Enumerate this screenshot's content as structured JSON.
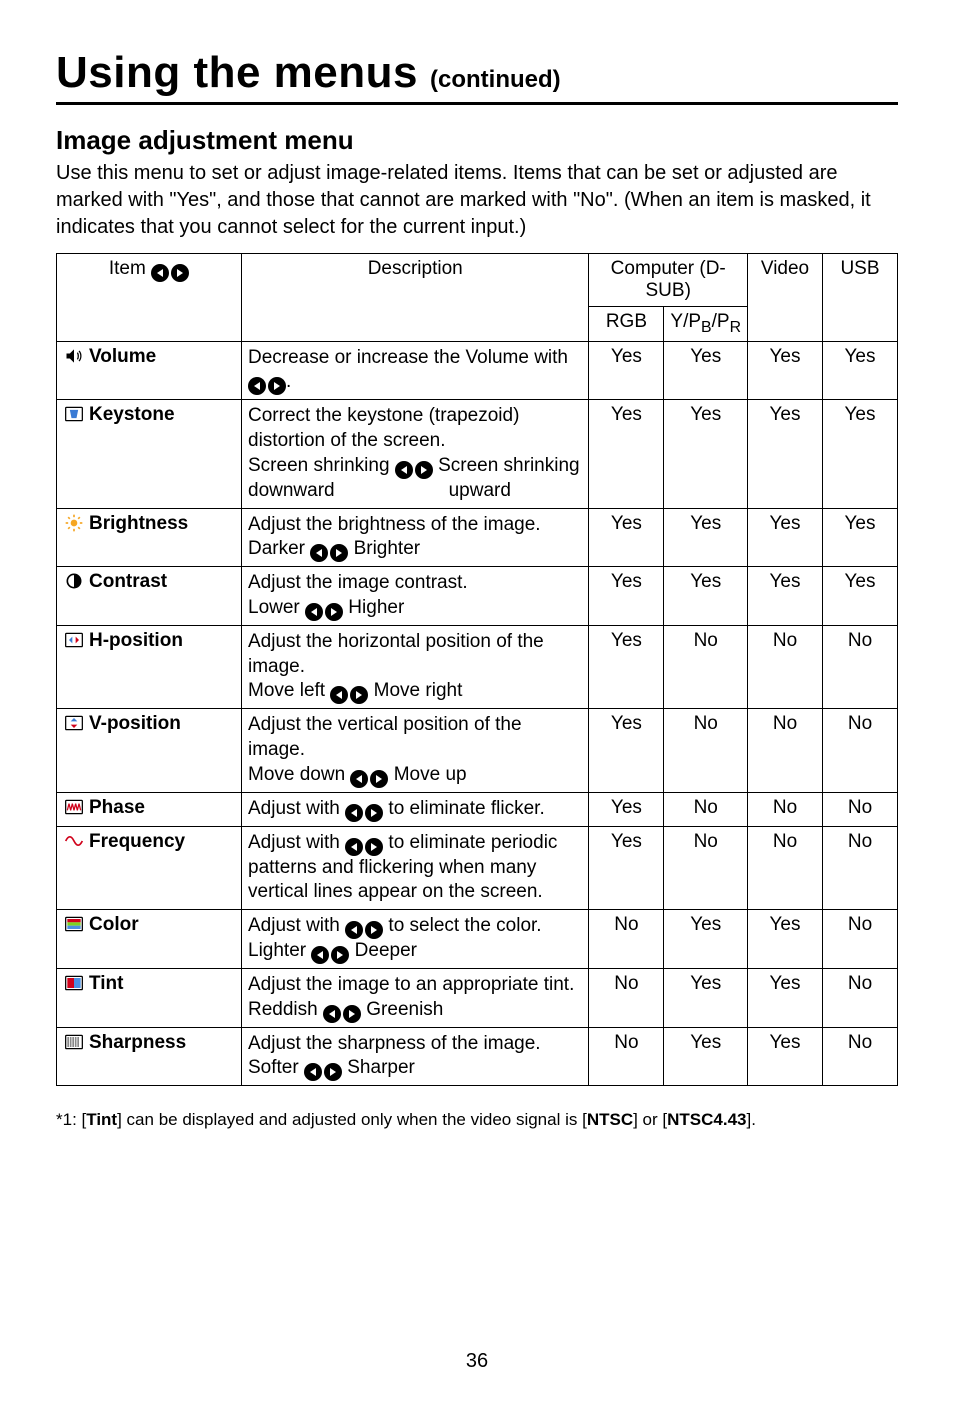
{
  "title": "Using the menus",
  "continued": "(continued)",
  "section_title": "Image adjustment menu",
  "section_intro": "Use this menu to set or adjust image-related items. Items that can be set or adjusted are marked with \"Yes\", and those that cannot are marked with \"No\". (When an item is masked, it indicates that you cannot select for the current input.)",
  "headers": {
    "item": "Item",
    "description": "Description",
    "dsub": "Computer (D-SUB)",
    "rgb": "RGB",
    "ypbpr": "Y/P",
    "ypbpr_b": "B",
    "ypbpr_sep": "/P",
    "ypbpr_r": "R",
    "video": "Video",
    "usb": "USB"
  },
  "rows": [
    {
      "icon": "volume",
      "label": "Volume",
      "desc_parts": [
        {
          "t": "text",
          "v": "Decrease or increase the Volume with "
        },
        {
          "t": "lr"
        },
        {
          "t": "text",
          "v": "."
        }
      ],
      "rgb": "Yes",
      "ypbpr": "Yes",
      "video": "Yes",
      "usb": "Yes"
    },
    {
      "icon": "keystone",
      "label": "Keystone",
      "desc_parts": [
        {
          "t": "text",
          "v": "Correct the keystone (trapezoid) distortion of the screen."
        },
        {
          "t": "br"
        },
        {
          "t": "text",
          "v": "Screen shrinking "
        },
        {
          "t": "lr"
        },
        {
          "t": "text",
          "v": " Screen shrinking"
        },
        {
          "t": "br"
        },
        {
          "t": "text",
          "v": "downward      upward"
        }
      ],
      "rgb": "Yes",
      "ypbpr": "Yes",
      "video": "Yes",
      "usb": "Yes"
    },
    {
      "icon": "brightness",
      "label": "Brightness",
      "desc_parts": [
        {
          "t": "text",
          "v": "Adjust the brightness of the image."
        },
        {
          "t": "br"
        },
        {
          "t": "text",
          "v": "Darker "
        },
        {
          "t": "lr"
        },
        {
          "t": "text",
          "v": " Brighter"
        }
      ],
      "rgb": "Yes",
      "ypbpr": "Yes",
      "video": "Yes",
      "usb": "Yes"
    },
    {
      "icon": "contrast",
      "label": "Contrast",
      "desc_parts": [
        {
          "t": "text",
          "v": "Adjust the image contrast."
        },
        {
          "t": "br"
        },
        {
          "t": "text",
          "v": "Lower "
        },
        {
          "t": "lr"
        },
        {
          "t": "text",
          "v": " Higher"
        }
      ],
      "rgb": "Yes",
      "ypbpr": "Yes",
      "video": "Yes",
      "usb": "Yes"
    },
    {
      "icon": "hpos",
      "label": "H-position",
      "desc_parts": [
        {
          "t": "text",
          "v": "Adjust the horizontal position of the image."
        },
        {
          "t": "br"
        },
        {
          "t": "text",
          "v": "Move left "
        },
        {
          "t": "lr"
        },
        {
          "t": "text",
          "v": " Move right"
        }
      ],
      "rgb": "Yes",
      "ypbpr": "No",
      "video": "No",
      "usb": "No"
    },
    {
      "icon": "vpos",
      "label": "V-position",
      "desc_parts": [
        {
          "t": "text",
          "v": "Adjust the vertical position of the image."
        },
        {
          "t": "br"
        },
        {
          "t": "text",
          "v": "Move down "
        },
        {
          "t": "lr"
        },
        {
          "t": "text",
          "v": " Move up"
        }
      ],
      "rgb": "Yes",
      "ypbpr": "No",
      "video": "No",
      "usb": "No"
    },
    {
      "icon": "phase",
      "label": "Phase",
      "desc_parts": [
        {
          "t": "text",
          "v": "Adjust with "
        },
        {
          "t": "lr"
        },
        {
          "t": "text",
          "v": " to eliminate flicker."
        }
      ],
      "rgb": "Yes",
      "ypbpr": "No",
      "video": "No",
      "usb": "No"
    },
    {
      "icon": "frequency",
      "label": "Frequency",
      "desc_parts": [
        {
          "t": "text",
          "v": "Adjust with "
        },
        {
          "t": "lr"
        },
        {
          "t": "text",
          "v": " to eliminate periodic patterns and flickering when many vertical lines appear on the screen."
        }
      ],
      "rgb": "Yes",
      "ypbpr": "No",
      "video": "No",
      "usb": "No"
    },
    {
      "icon": "color",
      "label": "Color",
      "desc_parts": [
        {
          "t": "text",
          "v": "Adjust with "
        },
        {
          "t": "lr"
        },
        {
          "t": "text",
          "v": " to select the color."
        },
        {
          "t": "br"
        },
        {
          "t": "text",
          "v": "Lighter "
        },
        {
          "t": "lr"
        },
        {
          "t": "text",
          "v": " Deeper"
        }
      ],
      "rgb": "No",
      "ypbpr": "Yes",
      "video": "Yes",
      "usb": "No"
    },
    {
      "icon": "tint",
      "label": "Tint",
      "desc_parts": [
        {
          "t": "text",
          "v": "Adjust the image to an appropriate tint."
        },
        {
          "t": "br"
        },
        {
          "t": "text",
          "v": "Reddish "
        },
        {
          "t": "lr"
        },
        {
          "t": "text",
          "v": " Greenish"
        }
      ],
      "rgb": "No",
      "ypbpr": "Yes",
      "video": "Yes",
      "usb": "No"
    },
    {
      "icon": "sharpness",
      "label": "Sharpness",
      "desc_parts": [
        {
          "t": "text",
          "v": "Adjust the sharpness of the image."
        },
        {
          "t": "br"
        },
        {
          "t": "text",
          "v": "Softer "
        },
        {
          "t": "lr"
        },
        {
          "t": "text",
          "v": " Sharper"
        }
      ],
      "rgb": "No",
      "ypbpr": "Yes",
      "video": "Yes",
      "usb": "No"
    }
  ],
  "footnote": {
    "prefix": "*1: [",
    "tint": "Tint",
    "mid": "] can be displayed and adjusted only when the video signal is [",
    "ntsc": "NTSC",
    "or": "] or [",
    "ntsc443": "NTSC4.43",
    "suffix": "]."
  },
  "page_number": "36"
}
